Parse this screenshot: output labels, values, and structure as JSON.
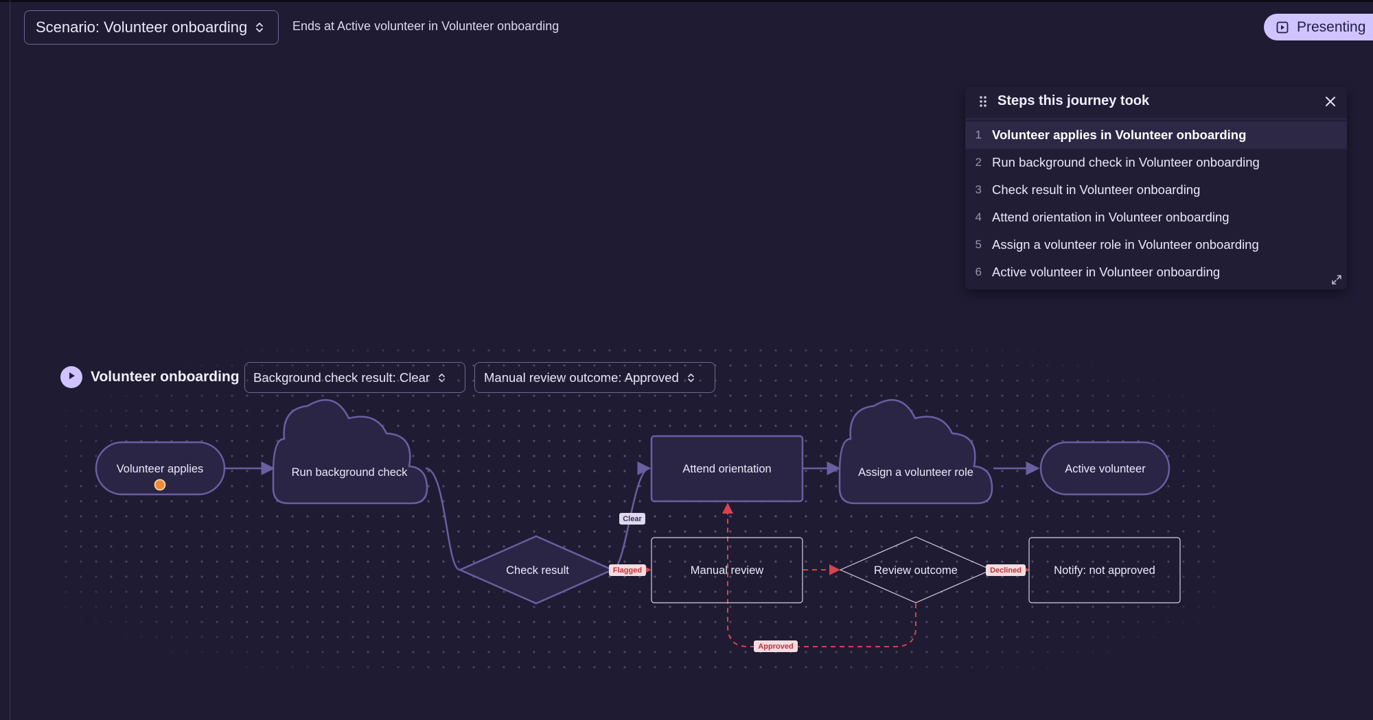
{
  "scenario": {
    "select_label": "Scenario: Volunteer onboarding",
    "ending_text": "Ends at Active volunteer in Volunteer onboarding"
  },
  "present": {
    "label": "Presenting",
    "icon": "present-icon"
  },
  "steps_panel": {
    "title": "Steps this journey took",
    "active_index": 0,
    "steps": [
      {
        "num": "1",
        "text": "Volunteer applies in Volunteer onboarding"
      },
      {
        "num": "2",
        "text": "Run background check in Volunteer onboarding"
      },
      {
        "num": "3",
        "text": "Check result in Volunteer onboarding"
      },
      {
        "num": "4",
        "text": "Attend orientation in Volunteer onboarding"
      },
      {
        "num": "5",
        "text": "Assign a volunteer role in Volunteer onboarding"
      },
      {
        "num": "6",
        "text": "Active volunteer in Volunteer onboarding"
      }
    ],
    "icons": [
      "drag-handle-icon",
      "close-icon",
      "expand-icon"
    ]
  },
  "flow": {
    "title": "Volunteer onboarding",
    "selects": {
      "background_check": "Background check result: Clear",
      "manual_review": "Manual review outcome: Approved"
    },
    "nodes": {
      "volunteer_applies": "Volunteer applies",
      "run_background_check": "Run background check",
      "check_result": "Check result",
      "attend_orientation": "Attend orientation",
      "assign_role": "Assign a volunteer role",
      "active_volunteer": "Active volunteer",
      "manual_review": "Manual review",
      "review_outcome": "Review outcome",
      "notify_not_approved": "Notify: not approved"
    },
    "edge_labels": {
      "clear": "Clear",
      "flagged": "Flagged",
      "declined": "Declined",
      "approved": "Approved"
    }
  },
  "colors": {
    "background": "#1f1b33",
    "accent": "#cfc4ff",
    "active_path": "#6a5fa0",
    "inactive_path": "#d9434b",
    "node_fill": "#2a2545"
  }
}
